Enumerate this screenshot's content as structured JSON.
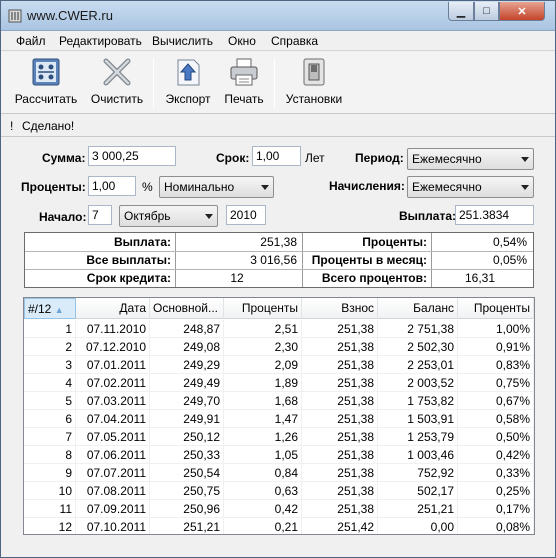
{
  "window": {
    "title": "www.CWER.ru"
  },
  "menu": [
    "Файл",
    "Редактировать",
    "Вычислить",
    "Окно",
    "Справка"
  ],
  "toolbar": {
    "calculate": "Рассчитать",
    "clear": "Очистить",
    "export": "Экспорт",
    "print": "Печать",
    "settings": "Установки"
  },
  "status": {
    "icon": "!",
    "text": "Сделано!"
  },
  "form": {
    "sum_label": "Сумма:",
    "sum_value": "3 000,25",
    "term_label": "Срок:",
    "term_value": "1,00",
    "term_unit": "Лет",
    "period_label": "Период:",
    "period_value": "Ежемесячно",
    "interest_label": "Проценты:",
    "interest_value": "1,00",
    "interest_unit": "%",
    "interest_type": "Номинально",
    "accrual_label": "Начисления:",
    "accrual_value": "Ежемесячно",
    "start_label": "Начало:",
    "start_day": "7",
    "start_month": "Октябрь",
    "start_year": "2010",
    "payment_label": "Выплата:",
    "payment_value": "251.3834"
  },
  "summary": {
    "payment_label": "Выплата:",
    "payment_value": "251,38",
    "all_payments_label": "Все выплаты:",
    "all_payments_value": "3 016,56",
    "term_label": "Срок кредита:",
    "term_value": "12",
    "interest_label": "Проценты:",
    "interest_value": "0,54%",
    "monthly_label": "Проценты в месяц:",
    "monthly_value": "0,05%",
    "total_label": "Всего процентов:",
    "total_value": "16,31"
  },
  "table": {
    "columns": [
      "#/12",
      "Дата",
      "Основной...",
      "Проценты",
      "Взнос",
      "Баланс",
      "Проценты"
    ],
    "rows": [
      [
        "1",
        "07.11.2010",
        "248,87",
        "2,51",
        "251,38",
        "2 751,38",
        "1,00%"
      ],
      [
        "2",
        "07.12.2010",
        "249,08",
        "2,30",
        "251,38",
        "2 502,30",
        "0,91%"
      ],
      [
        "3",
        "07.01.2011",
        "249,29",
        "2,09",
        "251,38",
        "2 253,01",
        "0,83%"
      ],
      [
        "4",
        "07.02.2011",
        "249,49",
        "1,89",
        "251,38",
        "2 003,52",
        "0,75%"
      ],
      [
        "5",
        "07.03.2011",
        "249,70",
        "1,68",
        "251,38",
        "1 753,82",
        "0,67%"
      ],
      [
        "6",
        "07.04.2011",
        "249,91",
        "1,47",
        "251,38",
        "1 503,91",
        "0,58%"
      ],
      [
        "7",
        "07.05.2011",
        "250,12",
        "1,26",
        "251,38",
        "1 253,79",
        "0,50%"
      ],
      [
        "8",
        "07.06.2011",
        "250,33",
        "1,05",
        "251,38",
        "1 003,46",
        "0,42%"
      ],
      [
        "9",
        "07.07.2011",
        "250,54",
        "0,84",
        "251,38",
        "752,92",
        "0,33%"
      ],
      [
        "10",
        "07.08.2011",
        "250,75",
        "0,63",
        "251,38",
        "502,17",
        "0,25%"
      ],
      [
        "11",
        "07.09.2011",
        "250,96",
        "0,42",
        "251,38",
        "251,21",
        "0,17%"
      ],
      [
        "12",
        "07.10.2011",
        "251,21",
        "0,21",
        "251,42",
        "0,00",
        "0,08%"
      ]
    ]
  }
}
